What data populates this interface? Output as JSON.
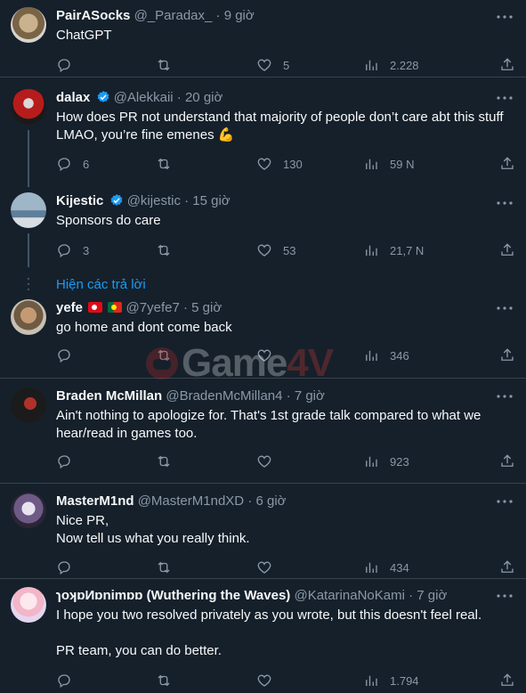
{
  "tweets": [
    {
      "name": "PairASocks",
      "handle": "@_Paradax_",
      "sep": "·",
      "time": "9 giờ",
      "text": "ChatGPT",
      "replies": "",
      "retweets": "",
      "likes": "5",
      "views": "2.228"
    },
    {
      "name": "dalax",
      "handle": "@Alekkaii",
      "sep": "·",
      "time": "20 giờ",
      "text": "How does PR not understand that majority of people don’t care abt this stuff LMAO, you’re fine emenes 💪",
      "replies": "6",
      "retweets": "",
      "likes": "130",
      "views": "59 N"
    },
    {
      "name": "Kijestic",
      "handle": "@kijestic",
      "sep": "·",
      "time": "15 giờ",
      "text": "Sponsors do care",
      "replies": "3",
      "retweets": "",
      "likes": "53",
      "views": "21,7 N"
    },
    {
      "name": "yefe",
      "handle": "@7yefe7",
      "sep": "·",
      "time": "5 giờ",
      "text": "go home and dont come back",
      "replies": "",
      "retweets": "",
      "likes": "",
      "views": "346"
    },
    {
      "name": "Braden McMillan",
      "handle": "@BradenMcMillan4",
      "sep": "·",
      "time": "7 giờ",
      "text": "Ain't nothing to apologize for. That's 1st grade talk compared to what we hear/read in games too.",
      "replies": "",
      "retweets": "",
      "likes": "",
      "views": "923"
    },
    {
      "name": "MasterM1nd",
      "handle": "@MasterM1ndXD",
      "sep": "·",
      "time": "6 giờ",
      "text": "Nice PR,\nNow tell us what you really think.",
      "replies": "",
      "retweets": "",
      "likes": "",
      "views": "434"
    },
    {
      "name": "ɿoʞɒИɒnimɒɒ (Wuthering the Waves)",
      "handle": "@KatarinaNoKami",
      "sep": "·",
      "time": "7 giờ",
      "text": "I hope you two resolved privately as you wrote, but this doesn't feel real.\n\nPR team, you can do better.",
      "replies": "",
      "retweets": "",
      "likes": "",
      "views": "1.794"
    }
  ],
  "show_replies": "Hiện các trả lời",
  "watermark": {
    "main": "Game",
    "accent": "4V"
  },
  "colors": {
    "background": "#15202b",
    "accent": "#1d9bf0",
    "muted": "#8b98a5",
    "divider": "#38444d",
    "verified": "#1d9bf0"
  }
}
